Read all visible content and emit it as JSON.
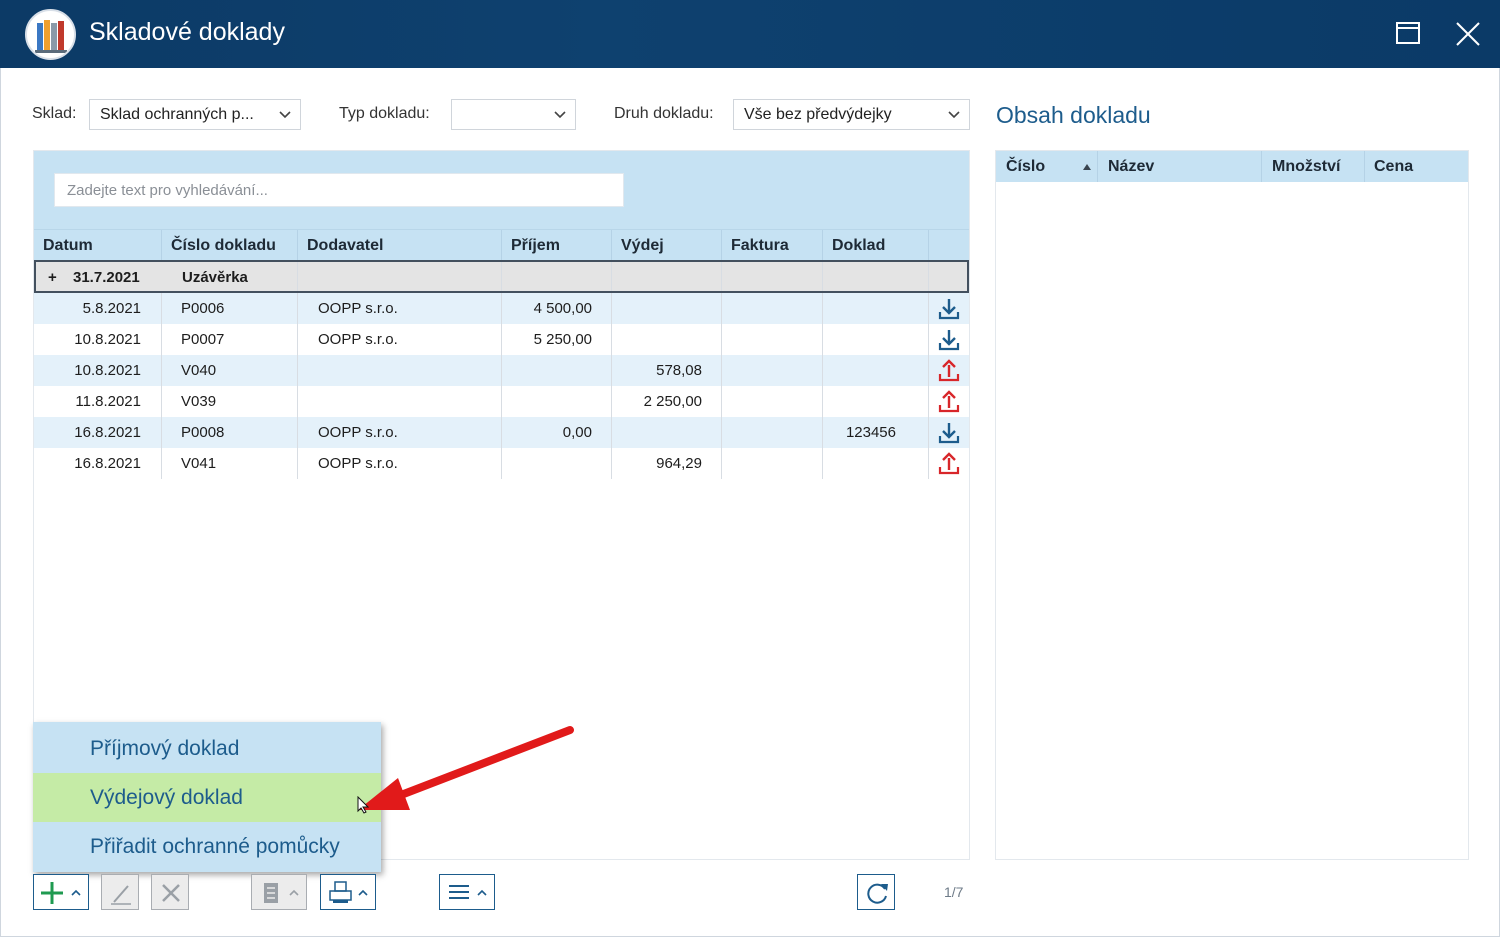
{
  "window": {
    "title": "Skladové doklady"
  },
  "filters": {
    "sklad_label": "Sklad:",
    "sklad_value": "Sklad ochranných p...",
    "typ_label": "Typ dokladu:",
    "typ_value": "",
    "druh_label": "Druh dokladu:",
    "druh_value": "Vše bez předvýdejky"
  },
  "search": {
    "placeholder": "Zadejte text pro vyhledávání..."
  },
  "columns": {
    "datum": "Datum",
    "cislo": "Číslo dokladu",
    "dodavatel": "Dodavatel",
    "prijem": "Příjem",
    "vydej": "Výdej",
    "faktura": "Faktura",
    "doklad": "Doklad"
  },
  "group": {
    "date": "31.7.2021",
    "label": "Uzávěrka"
  },
  "rows": [
    {
      "datum": "5.8.2021",
      "cislo": "P0006",
      "dodavatel": "OOPP s.r.o.",
      "prijem": "4 500,00",
      "vydej": "",
      "faktura": "",
      "doklad": "",
      "icon": "download-icon"
    },
    {
      "datum": "10.8.2021",
      "cislo": "P0007",
      "dodavatel": "OOPP s.r.o.",
      "prijem": "5 250,00",
      "vydej": "",
      "faktura": "",
      "doklad": "",
      "icon": "download-icon"
    },
    {
      "datum": "10.8.2021",
      "cislo": "V040",
      "dodavatel": "",
      "prijem": "",
      "vydej": "578,08",
      "faktura": "",
      "doklad": "",
      "icon": "upload-icon"
    },
    {
      "datum": "11.8.2021",
      "cislo": "V039",
      "dodavatel": "",
      "prijem": "",
      "vydej": "2 250,00",
      "faktura": "",
      "doklad": "",
      "icon": "upload-icon"
    },
    {
      "datum": "16.8.2021",
      "cislo": "P0008",
      "dodavatel": "OOPP s.r.o.",
      "prijem": "0,00",
      "vydej": "",
      "faktura": "",
      "doklad": "123456",
      "icon": "download-icon"
    },
    {
      "datum": "16.8.2021",
      "cislo": "V041",
      "dodavatel": "OOPP s.r.o.",
      "prijem": "",
      "vydej": "964,29",
      "faktura": "",
      "doklad": "",
      "icon": "upload-icon"
    }
  ],
  "right_panel": {
    "title": "Obsah dokladu",
    "columns": {
      "cislo": "Číslo",
      "nazev": "Název",
      "mnozstvi": "Množství",
      "cena": "Cena"
    }
  },
  "add_menu": {
    "items": [
      "Příjmový doklad",
      "Výdejový doklad",
      "Přiřadit ochranné pomůcky"
    ],
    "highlighted_index": 1
  },
  "pager": {
    "text": "1/7"
  },
  "colors": {
    "titlebar": "#0c3a66",
    "header": "#c6e2f3",
    "accent": "#1d5c8c",
    "highlight": "#c5eba6",
    "in": "#1d5c8c",
    "out": "#d8262a"
  }
}
